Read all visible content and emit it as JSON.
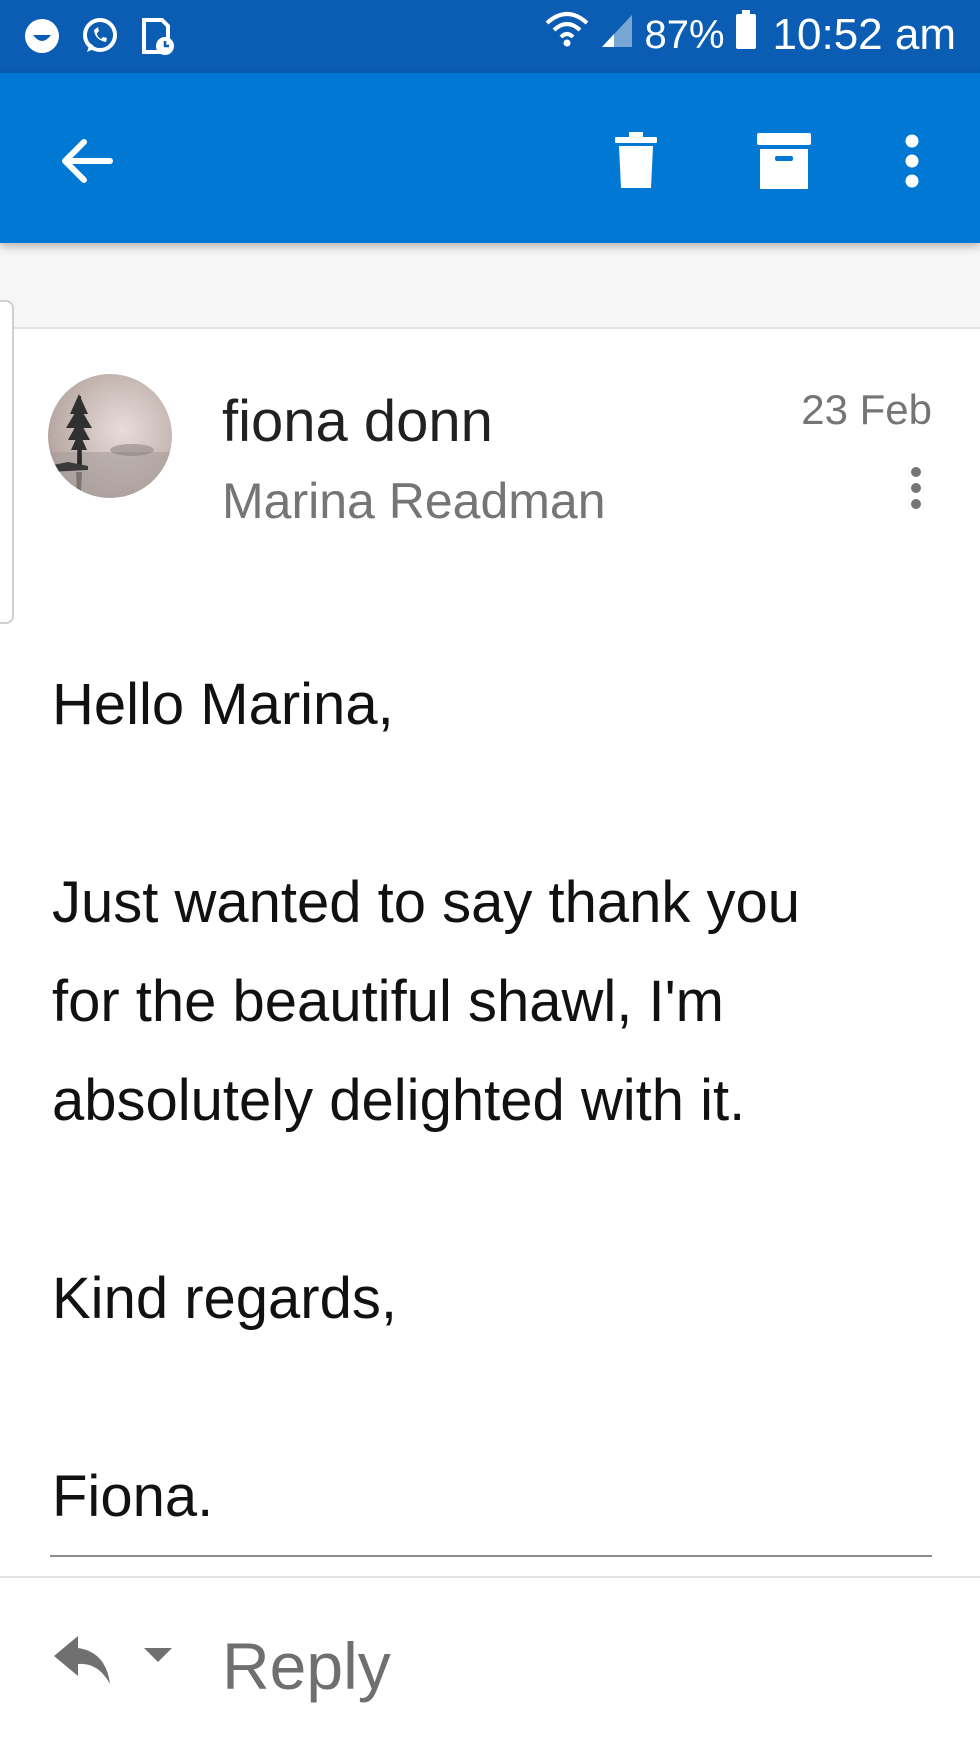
{
  "status_bar": {
    "battery_percent": "87%",
    "time": "10:52 am",
    "icons": [
      "smiley-notification-icon",
      "whatsapp-icon",
      "calendar-file-icon",
      "wifi-icon",
      "signal-icon",
      "battery-icon"
    ]
  },
  "app_bar": {
    "icons": [
      "back-arrow-icon",
      "trash-icon",
      "archive-icon",
      "overflow-menu-icon"
    ]
  },
  "message": {
    "sender": "fiona donn",
    "recipient": "Marina Readman",
    "date": "23 Feb",
    "body": {
      "greeting": "Hello Marina,",
      "line1": "Just wanted to say thank you",
      "line2": "for the beautiful shawl, I'm",
      "line3": "absolutely delighted with it.",
      "closing": "Kind regards,",
      "signature": "Fiona."
    }
  },
  "reply_bar": {
    "label": "Reply"
  },
  "colors": {
    "status_bar": "#0a5db2",
    "app_bar": "#0078d4",
    "text_primary": "#212121",
    "text_secondary": "#757575"
  }
}
